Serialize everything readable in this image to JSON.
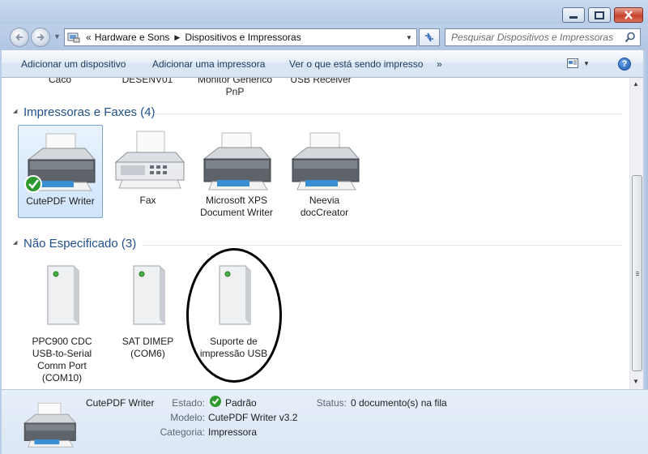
{
  "address": {
    "crumbs": [
      "Hardware e Sons",
      "Dispositivos e Impressoras"
    ]
  },
  "search": {
    "placeholder": "Pesquisar Dispositivos e Impressoras"
  },
  "commands": {
    "add_device": "Adicionar um dispositivo",
    "add_printer": "Adicionar uma impressora",
    "see_printing": "Ver o que está sendo impresso",
    "more": "»"
  },
  "help_label": "?",
  "top_row": [
    {
      "label": "Caco"
    },
    {
      "label": "DESENV01"
    },
    {
      "label": "Monitor Genérico PnP"
    },
    {
      "label": "USB Receiver"
    }
  ],
  "groups": {
    "printers": {
      "title": "Impressoras e Faxes (4)",
      "items": [
        {
          "label": "CutePDF Writer",
          "icon": "printer-icon",
          "default": true,
          "selected": true
        },
        {
          "label": "Fax",
          "icon": "fax-icon"
        },
        {
          "label": "Microsoft XPS Document Writer",
          "icon": "printer-icon"
        },
        {
          "label": "Neevia docCreator",
          "icon": "printer-icon"
        }
      ]
    },
    "unspecified": {
      "title": "Não Especificado (3)",
      "items": [
        {
          "label": "PPC900 CDC USB-to-Serial Comm Port (COM10)",
          "icon": "generic-device-icon"
        },
        {
          "label": "SAT DIMEP (COM6)",
          "icon": "generic-device-icon"
        },
        {
          "label": "Suporte de impressão USB",
          "icon": "generic-device-icon",
          "circled": true
        }
      ]
    }
  },
  "details": {
    "name": "CutePDF Writer",
    "estado_label": "Estado:",
    "estado_value": "Padrão",
    "status_label": "Status:",
    "status_value": "0 documento(s) na fila",
    "modelo_label": "Modelo:",
    "modelo_value": "CutePDF Writer v3.2",
    "categoria_label": "Categoria:",
    "categoria_value": "Impressora"
  },
  "colors": {
    "group_title": "#1e4f8c",
    "command_text": "#1e395b",
    "selection_bg": "#cfe4fb",
    "check_green": "#2e9a2e"
  }
}
